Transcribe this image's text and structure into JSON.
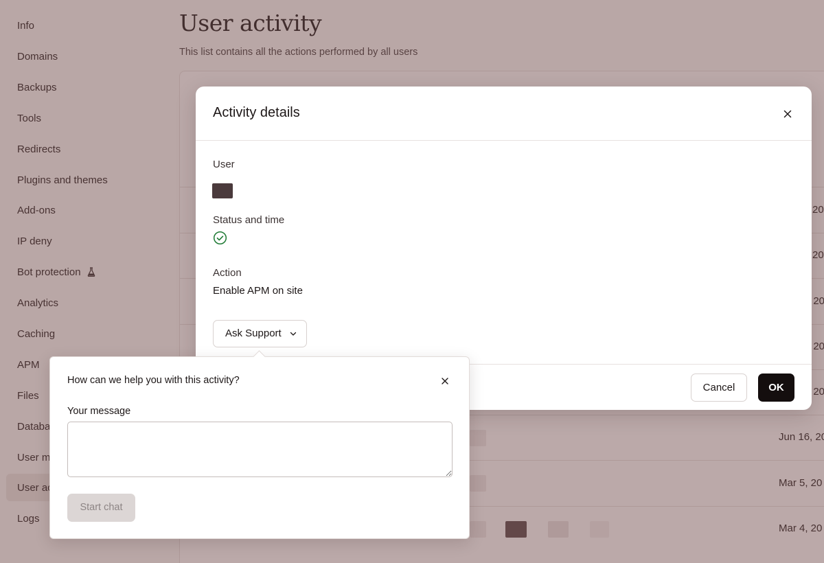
{
  "sidebar": {
    "items": [
      {
        "label": "Info"
      },
      {
        "label": "Domains"
      },
      {
        "label": "Backups"
      },
      {
        "label": "Tools"
      },
      {
        "label": "Redirects"
      },
      {
        "label": "Plugins and themes"
      },
      {
        "label": "Add-ons"
      },
      {
        "label": "IP deny"
      },
      {
        "label": "Bot protection"
      },
      {
        "label": "Analytics"
      },
      {
        "label": "Caching"
      },
      {
        "label": "APM"
      },
      {
        "label": "Files"
      },
      {
        "label": "Databa"
      },
      {
        "label": "User m"
      },
      {
        "label": "User ac"
      },
      {
        "label": "Logs"
      }
    ],
    "active_item": "User ac"
  },
  "page": {
    "title": "User activity",
    "subtitle": "This list contains all the actions performed by all users"
  },
  "table": {
    "dates": [
      "20",
      "20",
      ", 20",
      ", 20",
      ", 20",
      "Jun 16, 20",
      "Mar 5, 20",
      "Mar 4, 20"
    ]
  },
  "modal": {
    "title": "Activity details",
    "user_label": "User",
    "status_label": "Status and time",
    "action_label": "Action",
    "action_value": "Enable APM on site",
    "ask_support_label": "Ask Support",
    "cancel_label": "Cancel",
    "ok_label": "OK"
  },
  "popover": {
    "title": "How can we help you with this activity?",
    "message_label": "Your message",
    "message_value": "",
    "start_chat_label": "Start chat"
  },
  "icons": {
    "modal_close": "close-icon",
    "popover_close": "close-icon",
    "status": "check-circle-icon",
    "ask_support_chevron": "chevron-down-icon",
    "bot_protection": "flask-icon"
  },
  "colors": {
    "success": "#1e7a34",
    "primary_button": "#140e0e",
    "overlay": "#6c4848"
  }
}
